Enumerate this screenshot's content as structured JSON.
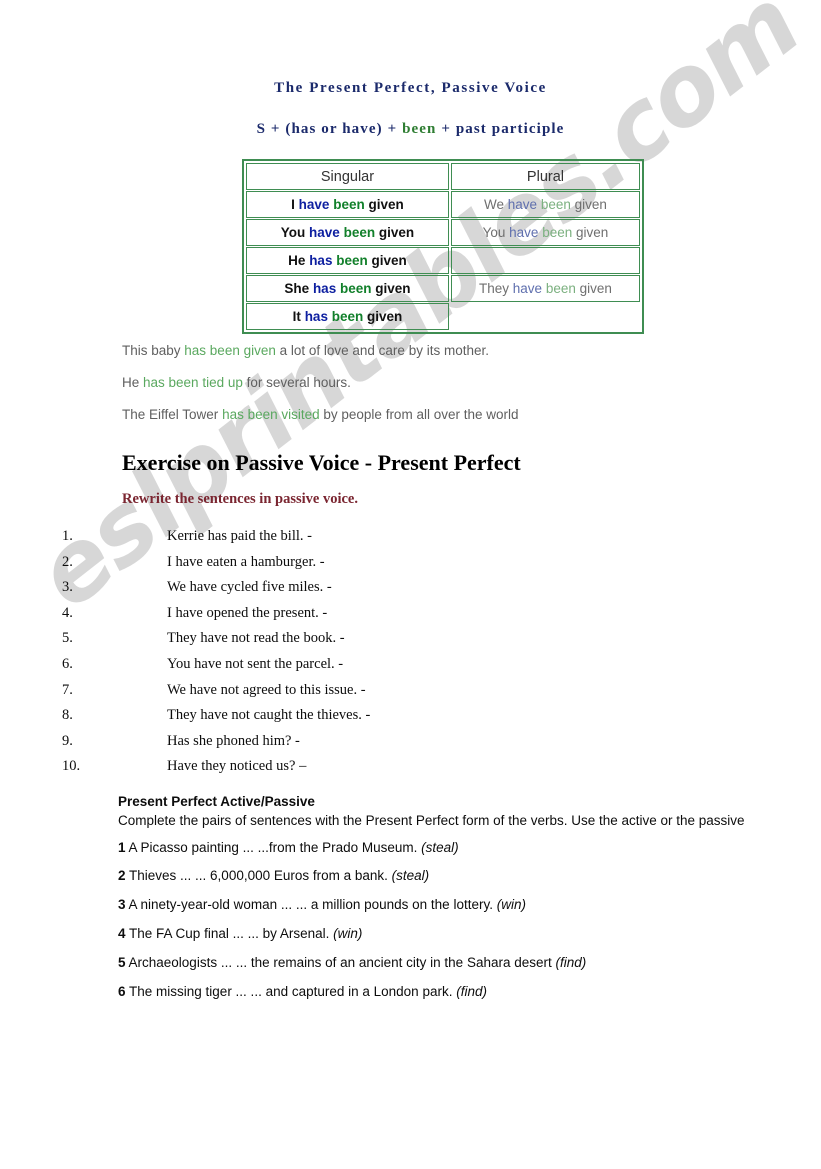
{
  "document": {
    "title": "The Present Perfect, Passive Voice",
    "formula": {
      "part1": "S + (has or have) + ",
      "been": "been",
      "part2": " + past participle"
    }
  },
  "colors": {
    "title_blue": "#1b2a6b",
    "green": "#2e7d32",
    "table_border_green": "#3f8d52",
    "aux_blue": "#0d1fa0",
    "maroon": "#7a2530",
    "example_gray": "#5f5f5f",
    "example_green": "#5aa85f",
    "watermark_gray": "#c9c9c9"
  },
  "watermark": {
    "text": "eslprintables.com"
  },
  "conjugation_table": {
    "headers": {
      "singular": "Singular",
      "plural": "Plural"
    },
    "rows": [
      {
        "singular": {
          "subject": "I",
          "aux": "have",
          "been": "been",
          "participle": "given"
        },
        "plural": {
          "subject": "We",
          "aux": "have",
          "been": "been",
          "participle": "given",
          "empty": false
        }
      },
      {
        "singular": {
          "subject": "You",
          "aux": "have",
          "been": "been",
          "participle": "given"
        },
        "plural": {
          "subject": "You",
          "aux": "have",
          "been": "been",
          "participle": "given",
          "empty": false
        }
      },
      {
        "singular": {
          "subject": "He",
          "aux": "has",
          "been": "been",
          "participle": "given"
        },
        "plural": {
          "subject": "",
          "aux": "",
          "been": "",
          "participle": "",
          "empty": true
        }
      },
      {
        "singular": {
          "subject": "She",
          "aux": "has",
          "been": "been",
          "participle": "given"
        },
        "plural": {
          "subject": "They",
          "aux": "have",
          "been": "been",
          "participle": "given",
          "empty": false
        }
      },
      {
        "singular": {
          "subject": "It",
          "aux": "has",
          "been": "been",
          "participle": "given"
        },
        "plural": {
          "subject": "",
          "aux": "",
          "been": "",
          "participle": "",
          "empty": true,
          "noborder": true
        }
      }
    ]
  },
  "examples": [
    {
      "before": "This baby ",
      "highlight": "has been given",
      "after": " a lot of love and care by its mother."
    },
    {
      "before": "He ",
      "highlight": "has been tied up",
      "after": " for several hours."
    },
    {
      "before": "The Eiffel Tower ",
      "highlight": "has been visited",
      "after": " by people from all over the world"
    }
  ],
  "exercise1": {
    "heading": "Exercise on Passive Voice - Present Perfect",
    "instruction": "Rewrite the sentences in passive voice.",
    "items": [
      {
        "num": "1.",
        "text": "Kerrie has paid the bill. -"
      },
      {
        "num": "2.",
        "text": "I have eaten a hamburger. -"
      },
      {
        "num": "3.",
        "text": "We have cycled five miles. -"
      },
      {
        "num": "4.",
        "text": "I have opened the present. -"
      },
      {
        "num": "5.",
        "text": "They have not read the book. -"
      },
      {
        "num": "6.",
        "text": "You have not sent the parcel.  -"
      },
      {
        "num": "7.",
        "text": "We have not agreed to this issue. -"
      },
      {
        "num": "8.",
        "text": "They have not caught the thieves. -"
      },
      {
        "num": "9.",
        "text": "Has she phoned him? -"
      },
      {
        "num": "10.",
        "text": "Have they noticed us? –"
      }
    ]
  },
  "exercise2": {
    "title": "Present Perfect Active/Passive",
    "intro": "Complete the pairs of sentences with the Present Perfect form of the verbs. Use the active or the passive",
    "items": [
      {
        "num": "1",
        "text": " A Picasso painting ... ...from the Prado Museum. ",
        "verb": "(steal)"
      },
      {
        "num": "2",
        "text": " Thieves ... ... 6,000,000 Euros from a bank. ",
        "verb": "(steal)"
      },
      {
        "num": "3",
        "text": " A ninety-year-old woman ... ... a million pounds on the lottery. ",
        "verb": "(win)"
      },
      {
        "num": "4",
        "text": " The FA Cup final ... ...  by Arsenal. ",
        "verb": "(win)"
      },
      {
        "num": "5",
        "text": " Archaeologists ... ...  the remains of an ancient city in the Sahara desert ",
        "verb": "(find)"
      },
      {
        "num": "6",
        "text": " The missing tiger ... ...  and captured in a London park. ",
        "verb": "(find)"
      }
    ]
  }
}
